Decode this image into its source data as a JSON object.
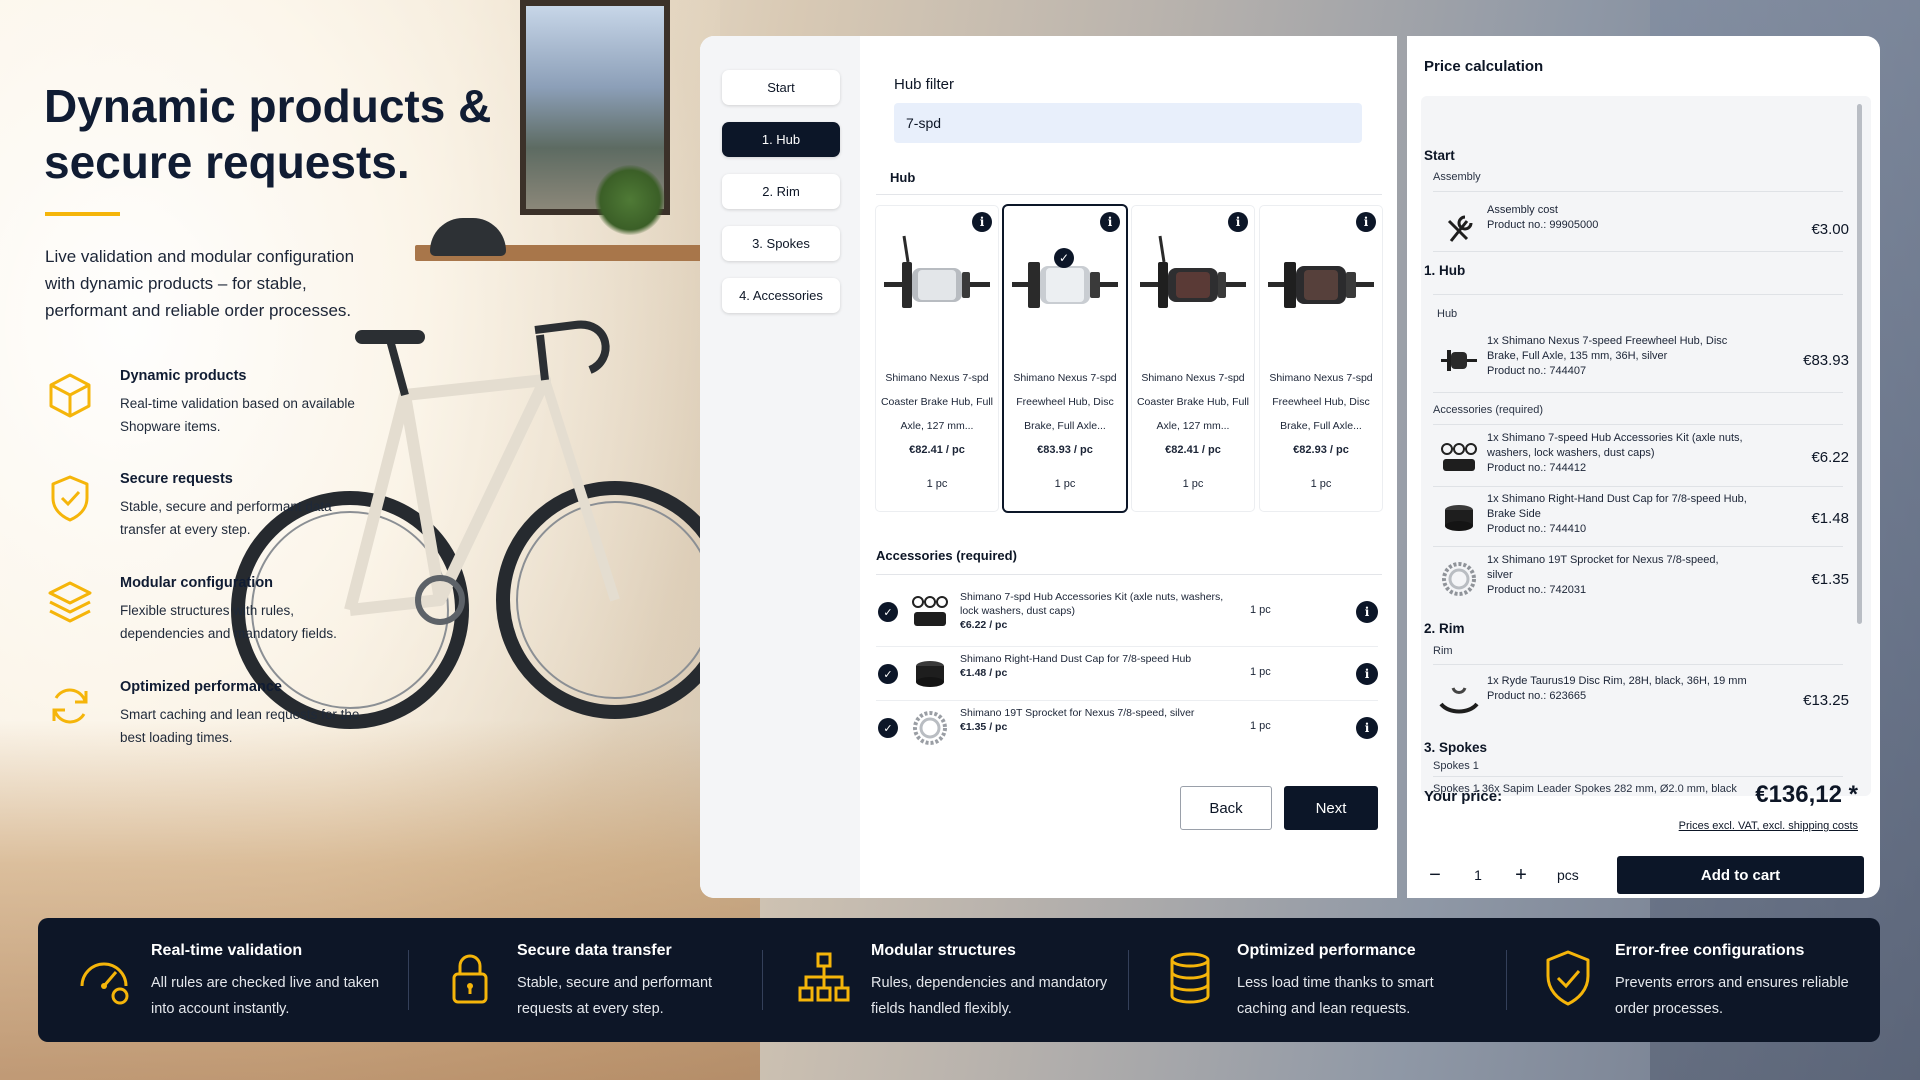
{
  "hero": {
    "title": "Dynamic products & secure requests.",
    "subtitle": "Live validation and modular configuration with dynamic products – for stable, performant and reliable order processes.",
    "accent_color": "#f5b50a",
    "features": [
      {
        "icon": "cube-icon",
        "title": "Dynamic products",
        "text": "Real-time validation based on available Shopware items."
      },
      {
        "icon": "shield-check-icon",
        "title": "Secure requests",
        "text": "Stable, secure and performant data transfer at every step."
      },
      {
        "icon": "layers-icon",
        "title": "Modular configuration",
        "text": "Flexible structures with rules, dependencies and mandatory fields."
      },
      {
        "icon": "refresh-icon",
        "title": "Optimized performance",
        "text": "Smart caching and lean requests for the best loading times."
      }
    ]
  },
  "configurator": {
    "steps": [
      "Start",
      "1. Hub",
      "2. Rim",
      "3. Spokes",
      "4. Accessories"
    ],
    "active_step": 1,
    "filter": {
      "label": "Hub filter",
      "value": "7-spd"
    },
    "hub_section": "Hub",
    "products": [
      {
        "name": "Shimano Nexus 7-spd Coaster Brake Hub, Full Axle, 127 mm...",
        "price": "€82.41 / pc",
        "qty": "1 pc",
        "selected": false,
        "info": "i"
      },
      {
        "name": "Shimano Nexus 7-spd Freewheel Hub, Disc Brake, Full Axle...",
        "price": "€83.93 / pc",
        "qty": "1 pc",
        "selected": true,
        "info": "i"
      },
      {
        "name": "Shimano Nexus 7-spd Coaster Brake Hub, Full Axle, 127 mm...",
        "price": "€82.41 / pc",
        "qty": "1 pc",
        "selected": false,
        "info": "i"
      },
      {
        "name": "Shimano Nexus 7-spd Freewheel Hub, Disc Brake, Full Axle...",
        "price": "€82.93 / pc",
        "qty": "1 pc",
        "selected": false,
        "info": "i"
      }
    ],
    "accessories_section": "Accessories (required)",
    "accessories": [
      {
        "name": "Shimano 7-spd Hub Accessories Kit (axle nuts, washers, lock washers, dust caps)",
        "price": "€6.22 / pc",
        "qty": "1 pc",
        "icon": "hub-kit-icon"
      },
      {
        "name": "Shimano Right-Hand Dust Cap for 7/8-speed Hub",
        "price": "€1.48 / pc",
        "qty": "1 pc",
        "icon": "dust-cap-icon"
      },
      {
        "name": "Shimano 19T Sprocket for Nexus 7/8-speed, silver",
        "price": "€1.35 / pc",
        "qty": "1 pc",
        "icon": "sprocket-icon"
      }
    ],
    "back_label": "Back",
    "next_label": "Next"
  },
  "price_panel": {
    "title": "Price calculation",
    "groups": [
      {
        "title": "Start",
        "sub": "Assembly",
        "items": [
          {
            "text": "Assembly cost",
            "product_no": "Product no.: 99905000",
            "price": "€3.00",
            "icon": "wrench-icon"
          }
        ]
      },
      {
        "title": "1. Hub",
        "sub": "Hub",
        "items": [
          {
            "text": "1x Shimano Nexus 7-speed Freewheel Hub, Disc Brake, Full Axle, 135 mm, 36H, silver",
            "product_no": "Product no.: 744407",
            "price": "€83.93",
            "icon": "hub-icon"
          }
        ],
        "sub2": "Accessories (required)",
        "items2": [
          {
            "text": "1x Shimano 7-speed Hub Accessories Kit (axle nuts, washers, lock washers, dust caps)",
            "product_no": "Product no.: 744412",
            "price": "€6.22",
            "icon": "hub-kit-icon"
          },
          {
            "text": "1x Shimano Right-Hand Dust Cap for 7/8-speed Hub, Brake Side",
            "product_no": "Product no.: 744410",
            "price": "€1.48",
            "icon": "dust-cap-icon"
          },
          {
            "text": "1x Shimano 19T Sprocket for Nexus 7/8-speed, silver",
            "product_no": "Product no.: 742031",
            "price": "€1.35",
            "icon": "sprocket-icon"
          }
        ]
      },
      {
        "title": "2. Rim",
        "sub": "Rim",
        "items": [
          {
            "text": "1x Ryde Taurus19 Disc Rim, 28H, black, 36H, 19 mm",
            "product_no": "Product no.: 623665",
            "price": "€13.25",
            "icon": "rim-icon"
          }
        ]
      },
      {
        "title": "3. Spokes",
        "sub": "Spokes 1",
        "items": [
          {
            "text": "Spokes 1   36x Sapim Leader Spokes 282 mm, Ø2.0 mm, black",
            "product_no": "",
            "price": "",
            "icon": ""
          }
        ]
      }
    ],
    "your_price_label": "Your price:",
    "your_price": "€136,12 *",
    "note": "Prices excl. VAT, excl. shipping costs",
    "qty_minus": "−",
    "qty_value": "1",
    "qty_plus": "+",
    "qty_unit": "pcs",
    "cart_label": "Add to cart"
  },
  "bottom_bar": [
    {
      "icon": "speedometer-icon",
      "title": "Real-time validation",
      "text": "All rules are checked live and taken into account instantly."
    },
    {
      "icon": "padlock-icon",
      "title": "Secure data transfer",
      "text": "Stable, secure and performant requests at every step."
    },
    {
      "icon": "hierarchy-icon",
      "title": "Modular structures",
      "text": "Rules, dependencies and mandatory fields handled flexibly."
    },
    {
      "icon": "database-icon",
      "title": "Optimized performance",
      "text": "Less load time thanks to smart caching and lean requests."
    },
    {
      "icon": "shield-check-icon",
      "title": "Error-free configurations",
      "text": "Prevents errors and ensures reliable order processes."
    }
  ]
}
